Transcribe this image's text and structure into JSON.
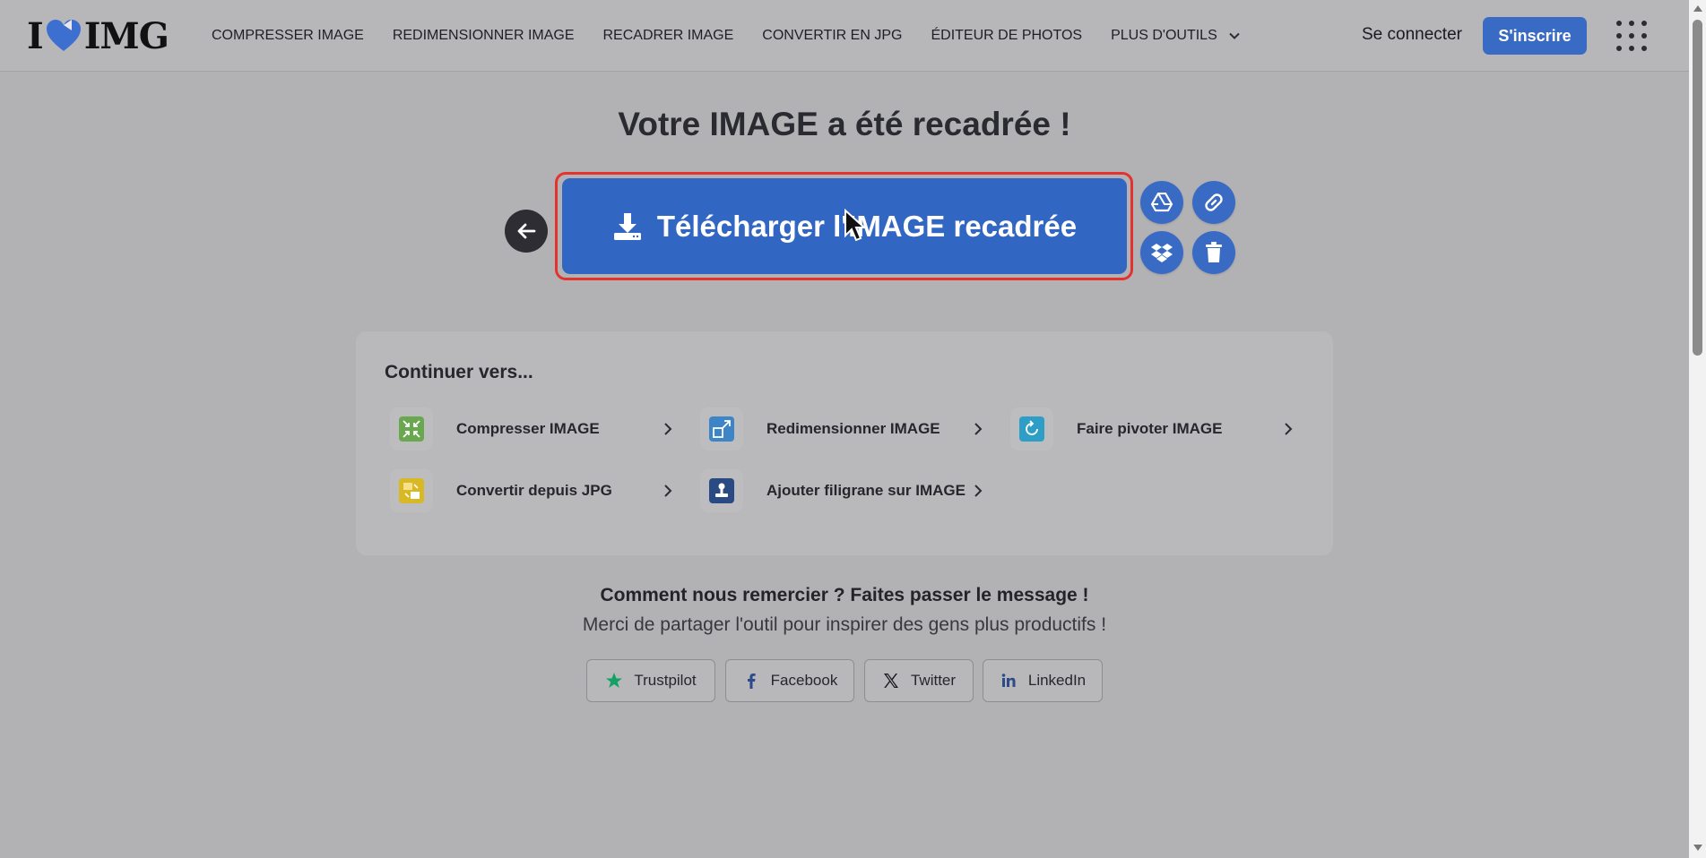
{
  "header": {
    "logo": {
      "left": "I",
      "right": "IMG"
    },
    "nav": [
      {
        "label": "COMPRESSER IMAGE"
      },
      {
        "label": "REDIMENSIONNER IMAGE"
      },
      {
        "label": "RECADRER IMAGE"
      },
      {
        "label": "CONVERTIR EN JPG"
      },
      {
        "label": "ÉDITEUR DE PHOTOS"
      },
      {
        "label": "PLUS D'OUTILS"
      }
    ],
    "login": "Se connecter",
    "signup": "S'inscrire"
  },
  "main": {
    "title": "Votre IMAGE a été recadrée !",
    "download_label": "Télécharger l'IMAGE recadrée",
    "side_actions": [
      "google-drive-icon",
      "link-icon",
      "dropbox-icon",
      "trash-icon"
    ]
  },
  "continue": {
    "title": "Continuer vers...",
    "tools": [
      {
        "label": "Compresser IMAGE",
        "color": "#6aa84f"
      },
      {
        "label": "Redimensionner IMAGE",
        "color": "#3d85c6"
      },
      {
        "label": "Faire pivoter IMAGE",
        "color": "#2e9ec7"
      },
      {
        "label": "Convertir depuis JPG",
        "color": "#d9b825"
      },
      {
        "label": "Ajouter filigrane sur IMAGE",
        "color": "#2a4a84"
      }
    ]
  },
  "thanks": {
    "title": "Comment nous remercier ? Faites passer le message !",
    "subtitle": "Merci de partager l'outil pour inspirer des gens plus productifs !",
    "share": [
      {
        "label": "Trustpilot"
      },
      {
        "label": "Facebook"
      },
      {
        "label": "Twitter"
      },
      {
        "label": "LinkedIn"
      }
    ]
  },
  "colors": {
    "accent": "#3266c3",
    "highlight": "#e4322e"
  }
}
